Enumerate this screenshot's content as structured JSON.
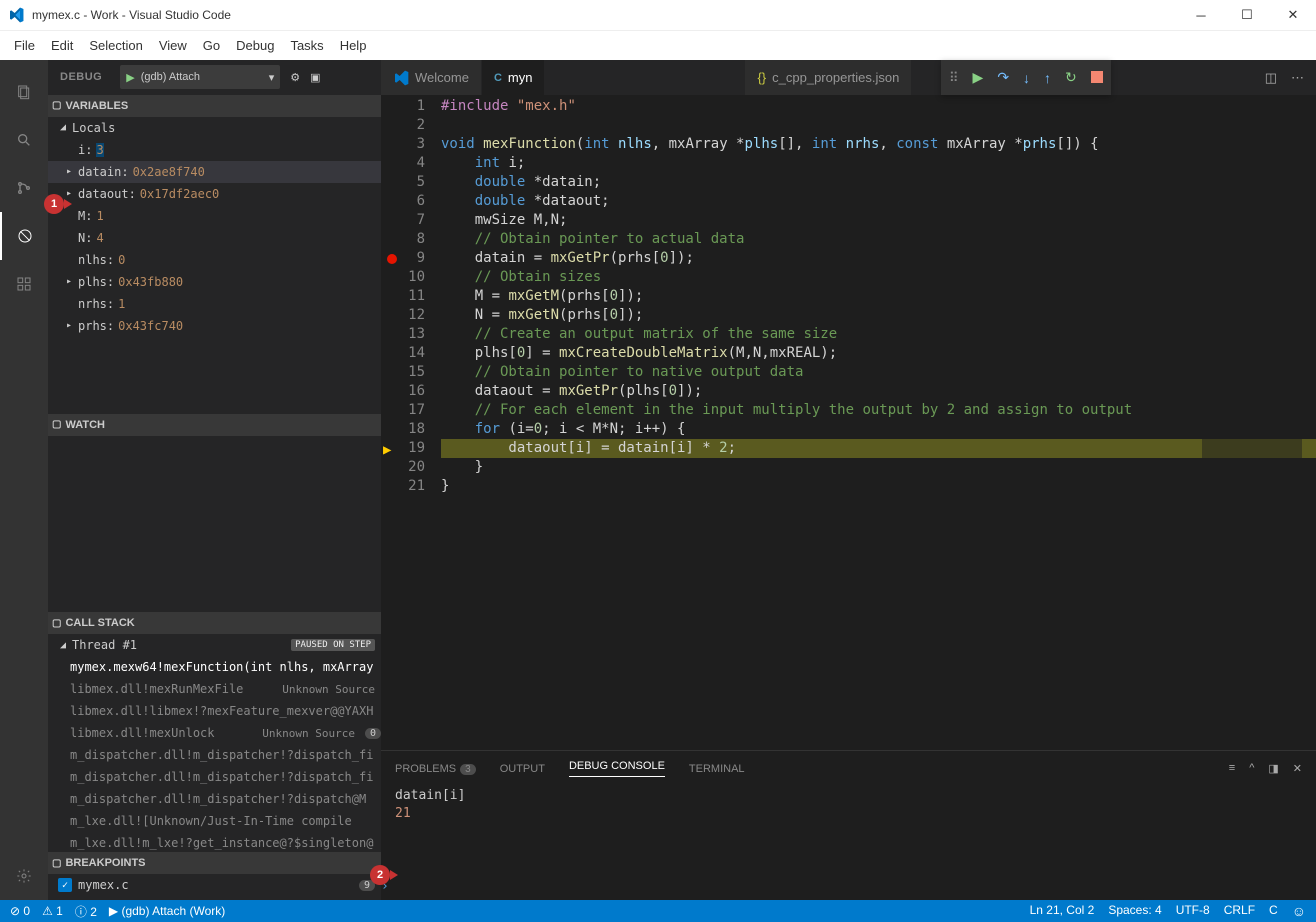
{
  "window": {
    "title": "mymex.c - Work - Visual Studio Code"
  },
  "menu": [
    "File",
    "Edit",
    "Selection",
    "View",
    "Go",
    "Debug",
    "Tasks",
    "Help"
  ],
  "debug": {
    "label": "DEBUG",
    "config": "(gdb) Attach"
  },
  "variables": {
    "title": "VARIABLES",
    "locals_label": "Locals",
    "items": [
      {
        "name": "i:",
        "value": "3",
        "highlight": true
      },
      {
        "name": "datain:",
        "value": "0x2ae8f740",
        "expandable": true,
        "hover": true
      },
      {
        "name": "dataout:",
        "value": "0x17df2aec0",
        "expandable": true
      },
      {
        "name": "M:",
        "value": "1"
      },
      {
        "name": "N:",
        "value": "4"
      },
      {
        "name": "nlhs:",
        "value": "0"
      },
      {
        "name": "plhs:",
        "value": "0x43fb880",
        "expandable": true
      },
      {
        "name": "nrhs:",
        "value": "1"
      },
      {
        "name": "prhs:",
        "value": "0x43fc740",
        "expandable": true
      }
    ]
  },
  "watch": {
    "title": "WATCH"
  },
  "callstack": {
    "title": "CALL STACK",
    "thread": "Thread #1",
    "status": "PAUSED ON STEP",
    "frames": [
      {
        "fn": "mymex.mexw64!mexFunction(int nlhs, mxArray",
        "src": "",
        "top": true
      },
      {
        "fn": "libmex.dll!mexRunMexFile",
        "src": "Unknown Source"
      },
      {
        "fn": "libmex.dll!libmex!?mexFeature_mexver@@YAXH"
      },
      {
        "fn": "libmex.dll!mexUnlock",
        "src": "Unknown Source",
        "count": "0"
      },
      {
        "fn": "m_dispatcher.dll!m_dispatcher!?dispatch_fi"
      },
      {
        "fn": "m_dispatcher.dll!m_dispatcher!?dispatch_fi"
      },
      {
        "fn": "m_dispatcher.dll!m_dispatcher!?dispatch@M"
      },
      {
        "fn": "m_lxe.dll![Unknown/Just-In-Time compile"
      },
      {
        "fn": "m_lxe.dll!m_lxe!?get_instance@?$singleton@"
      }
    ]
  },
  "breakpoints": {
    "title": "BREAKPOINTS",
    "items": [
      {
        "file": "mymex.c",
        "count": "9"
      }
    ]
  },
  "tabs": {
    "welcome": "Welcome",
    "active_file": "myn",
    "json_file": "c_cpp_properties.json"
  },
  "code_lines": [
    {
      "n": 1,
      "tokens": [
        [
          "pp",
          "#include"
        ],
        [
          "pn",
          " "
        ],
        [
          "str",
          "\"mex.h\""
        ]
      ]
    },
    {
      "n": 2,
      "tokens": []
    },
    {
      "n": 3,
      "tokens": [
        [
          "kw",
          "void"
        ],
        [
          "pn",
          " "
        ],
        [
          "fn",
          "mexFunction"
        ],
        [
          "pn",
          "("
        ],
        [
          "kw",
          "int"
        ],
        [
          "pn",
          " "
        ],
        [
          "par",
          "nlhs"
        ],
        [
          "pn",
          ", mxArray *"
        ],
        [
          "par",
          "plhs"
        ],
        [
          "pn",
          "[], "
        ],
        [
          "kw",
          "int"
        ],
        [
          "pn",
          " "
        ],
        [
          "par",
          "nrhs"
        ],
        [
          "pn",
          ", "
        ],
        [
          "kw",
          "const"
        ],
        [
          "pn",
          " mxArray *"
        ],
        [
          "par",
          "prhs"
        ],
        [
          "pn",
          "[]) {"
        ]
      ]
    },
    {
      "n": 4,
      "tokens": [
        [
          "pn",
          "    "
        ],
        [
          "kw",
          "int"
        ],
        [
          "pn",
          " i;"
        ]
      ]
    },
    {
      "n": 5,
      "tokens": [
        [
          "pn",
          "    "
        ],
        [
          "kw",
          "double"
        ],
        [
          "pn",
          " *datain;"
        ]
      ]
    },
    {
      "n": 6,
      "tokens": [
        [
          "pn",
          "    "
        ],
        [
          "kw",
          "double"
        ],
        [
          "pn",
          " *dataout;"
        ]
      ]
    },
    {
      "n": 7,
      "tokens": [
        [
          "pn",
          "    mwSize M,N;"
        ]
      ]
    },
    {
      "n": 8,
      "tokens": [
        [
          "pn",
          "    "
        ],
        [
          "cmt",
          "// Obtain pointer to actual data"
        ]
      ]
    },
    {
      "n": 9,
      "bp": true,
      "tokens": [
        [
          "pn",
          "    datain = "
        ],
        [
          "fn",
          "mxGetPr"
        ],
        [
          "pn",
          "(prhs["
        ],
        [
          "num",
          "0"
        ],
        [
          "pn",
          "]);"
        ]
      ]
    },
    {
      "n": 10,
      "tokens": [
        [
          "pn",
          "    "
        ],
        [
          "cmt",
          "// Obtain sizes"
        ]
      ]
    },
    {
      "n": 11,
      "tokens": [
        [
          "pn",
          "    M = "
        ],
        [
          "fn",
          "mxGetM"
        ],
        [
          "pn",
          "(prhs["
        ],
        [
          "num",
          "0"
        ],
        [
          "pn",
          "]);"
        ]
      ]
    },
    {
      "n": 12,
      "tokens": [
        [
          "pn",
          "    N = "
        ],
        [
          "fn",
          "mxGetN"
        ],
        [
          "pn",
          "(prhs["
        ],
        [
          "num",
          "0"
        ],
        [
          "pn",
          "]);"
        ]
      ]
    },
    {
      "n": 13,
      "tokens": [
        [
          "pn",
          "    "
        ],
        [
          "cmt",
          "// Create an output matrix of the same size"
        ]
      ]
    },
    {
      "n": 14,
      "tokens": [
        [
          "pn",
          "    plhs["
        ],
        [
          "num",
          "0"
        ],
        [
          "pn",
          "] = "
        ],
        [
          "fn",
          "mxCreateDoubleMatrix"
        ],
        [
          "pn",
          "(M,N,mxREAL);"
        ]
      ]
    },
    {
      "n": 15,
      "tokens": [
        [
          "pn",
          "    "
        ],
        [
          "cmt",
          "// Obtain pointer to native output data"
        ]
      ]
    },
    {
      "n": 16,
      "tokens": [
        [
          "pn",
          "    dataout = "
        ],
        [
          "fn",
          "mxGetPr"
        ],
        [
          "pn",
          "(plhs["
        ],
        [
          "num",
          "0"
        ],
        [
          "pn",
          "]);"
        ]
      ]
    },
    {
      "n": 17,
      "tokens": [
        [
          "pn",
          "    "
        ],
        [
          "cmt",
          "// For each element in the input multiply the output by 2 and assign to output"
        ]
      ]
    },
    {
      "n": 18,
      "tokens": [
        [
          "pn",
          "    "
        ],
        [
          "kw",
          "for"
        ],
        [
          "pn",
          " (i="
        ],
        [
          "num",
          "0"
        ],
        [
          "pn",
          "; i < M*N; i++) {"
        ]
      ]
    },
    {
      "n": 19,
      "exec": true,
      "highlight": true,
      "tokens": [
        [
          "pn",
          "        dataout[i] = datain[i] * "
        ],
        [
          "num",
          "2"
        ],
        [
          "pn",
          ";"
        ]
      ]
    },
    {
      "n": 20,
      "tokens": [
        [
          "pn",
          "    }"
        ]
      ]
    },
    {
      "n": 21,
      "tokens": [
        [
          "pn",
          "}"
        ]
      ]
    }
  ],
  "panel": {
    "tabs": {
      "problems": "PROBLEMS",
      "problems_count": "3",
      "output": "OUTPUT",
      "debug": "DEBUG CONSOLE",
      "terminal": "TERMINAL"
    },
    "output": [
      "datain[i]",
      "21"
    ]
  },
  "status": {
    "errors": "0",
    "warnings": "1",
    "info": "2",
    "process": "(gdb) Attach (Work)",
    "ln_col": "Ln 21, Col 2",
    "spaces": "Spaces: 4",
    "encoding": "UTF-8",
    "eol": "CRLF",
    "lang": "C"
  },
  "callouts": {
    "one": "1",
    "two": "2"
  }
}
